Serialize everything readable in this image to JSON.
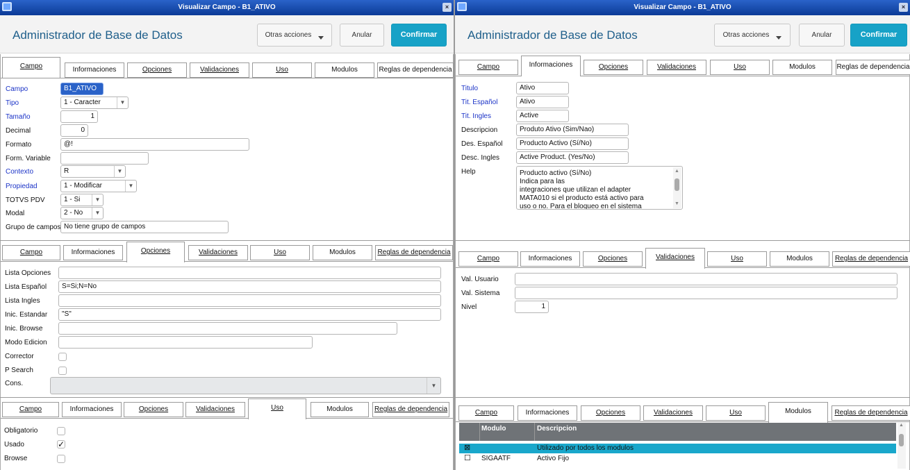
{
  "window": {
    "title": "Visualizar Campo - B1_ATIVO",
    "close_glyph": "×"
  },
  "header": {
    "app_title": "Administrador de Base de Datos",
    "other_actions": "Otras acciones",
    "cancel": "Anular",
    "confirm": "Confirmar"
  },
  "tabs": {
    "campo": "Campo",
    "informaciones": "Informaciones",
    "opciones": "Opciones",
    "validaciones": "Validaciones",
    "uso": "Uso",
    "modulos": "Modulos",
    "reglas": "Reglas de dependencia"
  },
  "campo": {
    "campo_label": "Campo",
    "campo_value": "B1_ATIVO",
    "tipo_label": "Tipo",
    "tipo_value": "1 - Caracter",
    "tamano_label": "Tamaño",
    "tamano_value": "1",
    "decimal_label": "Decimal",
    "decimal_value": "0",
    "formato_label": "Formato",
    "formato_value": "@!",
    "form_variable_label": "Form. Variable",
    "form_variable_value": "",
    "contexto_label": "Contexto",
    "contexto_value": "R",
    "propiedad_label": "Propiedad",
    "propiedad_value": "1 - Modificar",
    "totvs_pdv_label": "TOTVS PDV",
    "totvs_pdv_value": "1 - Si",
    "modal_label": "Modal",
    "modal_value": "2 - No",
    "grupo_label": "Grupo de campos",
    "grupo_value": "No tiene grupo de campos"
  },
  "informaciones": {
    "titulo_label": "Titulo",
    "titulo_value": "Ativo",
    "tit_espanol_label": "Tit. Español",
    "tit_espanol_value": "Ativo",
    "tit_ingles_label": "Tit. Ingles",
    "tit_ingles_value": "Active",
    "descripcion_label": "Descripcion",
    "descripcion_value": "Produto Ativo (Sim/Nao)",
    "des_espanol_label": "Des. Español",
    "des_espanol_value": "Producto Activo (Sí/No)",
    "desc_ingles_label": "Desc. Ingles",
    "desc_ingles_value": "Active Product. (Yes/No)",
    "help_label": "Help",
    "help_line1": "Producto activo (Sí/No)",
    "help_line2": "Indica para las",
    "help_line3": "integraciones que utilizan el adapter",
    "help_line4": "MATA010 si el producto está activo para",
    "help_line5": "uso o no. Para el bloqueo en el sistema"
  },
  "opciones": {
    "lista_opciones_label": "Lista Opciones",
    "lista_opciones_value": "",
    "lista_espanol_label": "Lista Español",
    "lista_espanol_value": "S=Si;N=No",
    "lista_ingles_label": "Lista Ingles",
    "lista_ingles_value": "",
    "inic_estandar_label": "Inic. Estandar",
    "inic_estandar_value": "\"S\"",
    "inic_browse_label": "Inic. Browse",
    "inic_browse_value": "",
    "modo_edicion_label": "Modo Edicion",
    "modo_edicion_value": "",
    "corrector_label": "Corrector",
    "corrector_checked": false,
    "p_search_label": "P Search",
    "p_search_checked": false,
    "cons_label": "Cons.",
    "cons_value": ""
  },
  "validaciones": {
    "val_usuario_label": "Val. Usuario",
    "val_usuario_value": "",
    "val_sistema_label": "Val. Sistema",
    "val_sistema_value": "",
    "nivel_label": "Nivel",
    "nivel_value": "1"
  },
  "uso": {
    "obligatorio_label": "Obligatorio",
    "obligatorio_checked": false,
    "usado_label": "Usado",
    "usado_checked": true,
    "check_glyph": "✓",
    "browse_label": "Browse",
    "browse_checked": false
  },
  "modulos": {
    "col_modulo": "Modulo",
    "col_descripcion": "Descripcion",
    "rows": [
      {
        "checked": true,
        "glyph": "⊠",
        "modulo": "",
        "descripcion": "Utilizado por todos los modulos",
        "highlight": true
      },
      {
        "checked": false,
        "glyph": "☐",
        "modulo": "SIGAATF",
        "descripcion": "Activo Fijo",
        "highlight": false
      }
    ]
  },
  "icons": {
    "window_icon": "window-icon",
    "dropdown_arrow": "▼",
    "scroll_up": "▲",
    "scroll_down": "▼"
  },
  "colors": {
    "titlebar": "#0b3a96",
    "confirm": "#17a2c7",
    "label_blue": "#1b33c7",
    "grid_header": "#6f7377",
    "row_highlight": "#19a7cb"
  }
}
